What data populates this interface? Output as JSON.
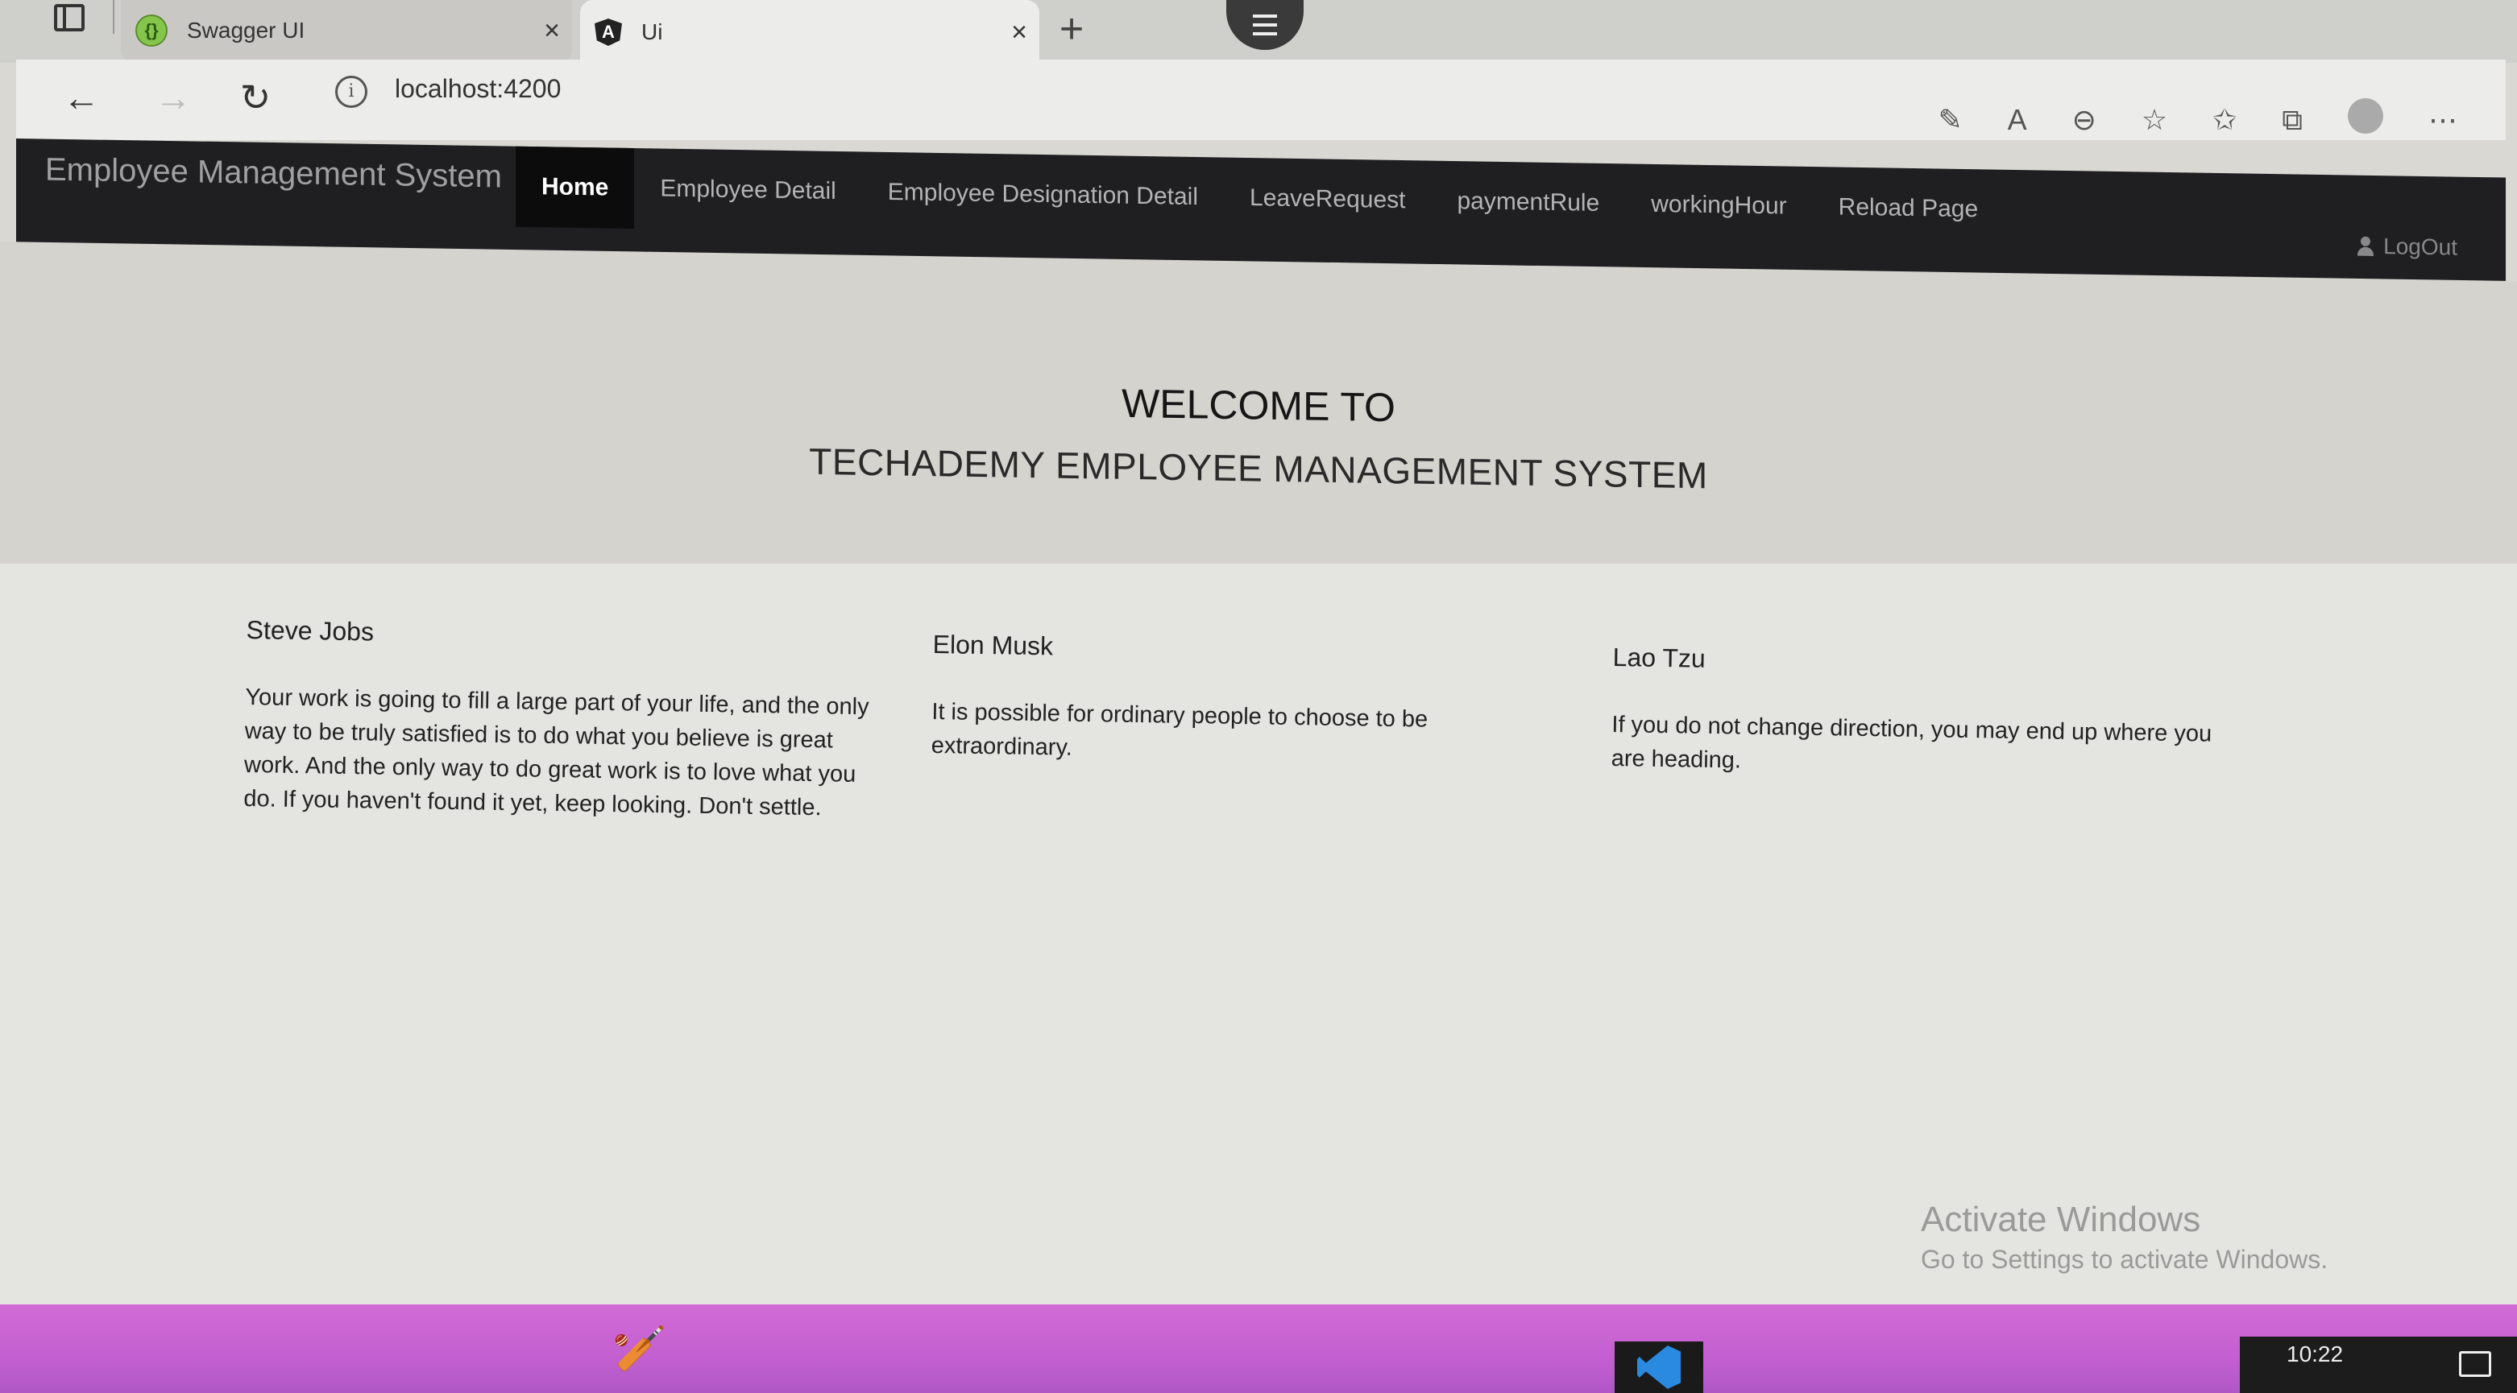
{
  "browser": {
    "tabs": [
      {
        "title": "Swagger UI",
        "favicon": "swagger-icon",
        "active": false
      },
      {
        "title": "Ui",
        "favicon": "angular-icon",
        "active": true
      }
    ],
    "new_tab_label": "+",
    "close_label": "×",
    "url": "localhost:4200"
  },
  "app": {
    "brand": "Employee Management System",
    "nav": [
      {
        "label": "Home",
        "active": true
      },
      {
        "label": "Employee Detail",
        "active": false
      },
      {
        "label": "Employee Designation Detail",
        "active": false
      },
      {
        "label": "LeaveRequest",
        "active": false
      },
      {
        "label": "paymentRule",
        "active": false
      },
      {
        "label": "workingHour",
        "active": false
      },
      {
        "label": "Reload Page",
        "active": false
      }
    ],
    "logout_label": "LogOut"
  },
  "hero": {
    "welcome": "WELCOME TO",
    "subtitle": "TECHADEMY EMPLOYEE MANAGEMENT SYSTEM"
  },
  "quotes": [
    {
      "author": "Steve Jobs",
      "text": "Your work is going to fill a large part of your life, and the only way to be truly satisfied is to do what you believe is great work. And the only way to do great work is to love what you do. If you haven't found it yet, keep looking. Don't settle."
    },
    {
      "author": "Elon Musk",
      "text": "It is possible for ordinary people to choose to be extraordinary."
    },
    {
      "author": "Lao Tzu",
      "text": "If you do not change direction, you may end up where you are heading."
    }
  ],
  "watermark": {
    "line1": "Activate Windows",
    "line2": "Go to Settings to activate Windows."
  },
  "taskbar": {
    "clock": "10:22"
  },
  "colors": {
    "navbar_bg": "#1f1f22",
    "nav_active_bg": "#0c0c0c",
    "jumbotron_bg": "#d4d3ce",
    "taskbar_bg": "#c35fd0"
  }
}
